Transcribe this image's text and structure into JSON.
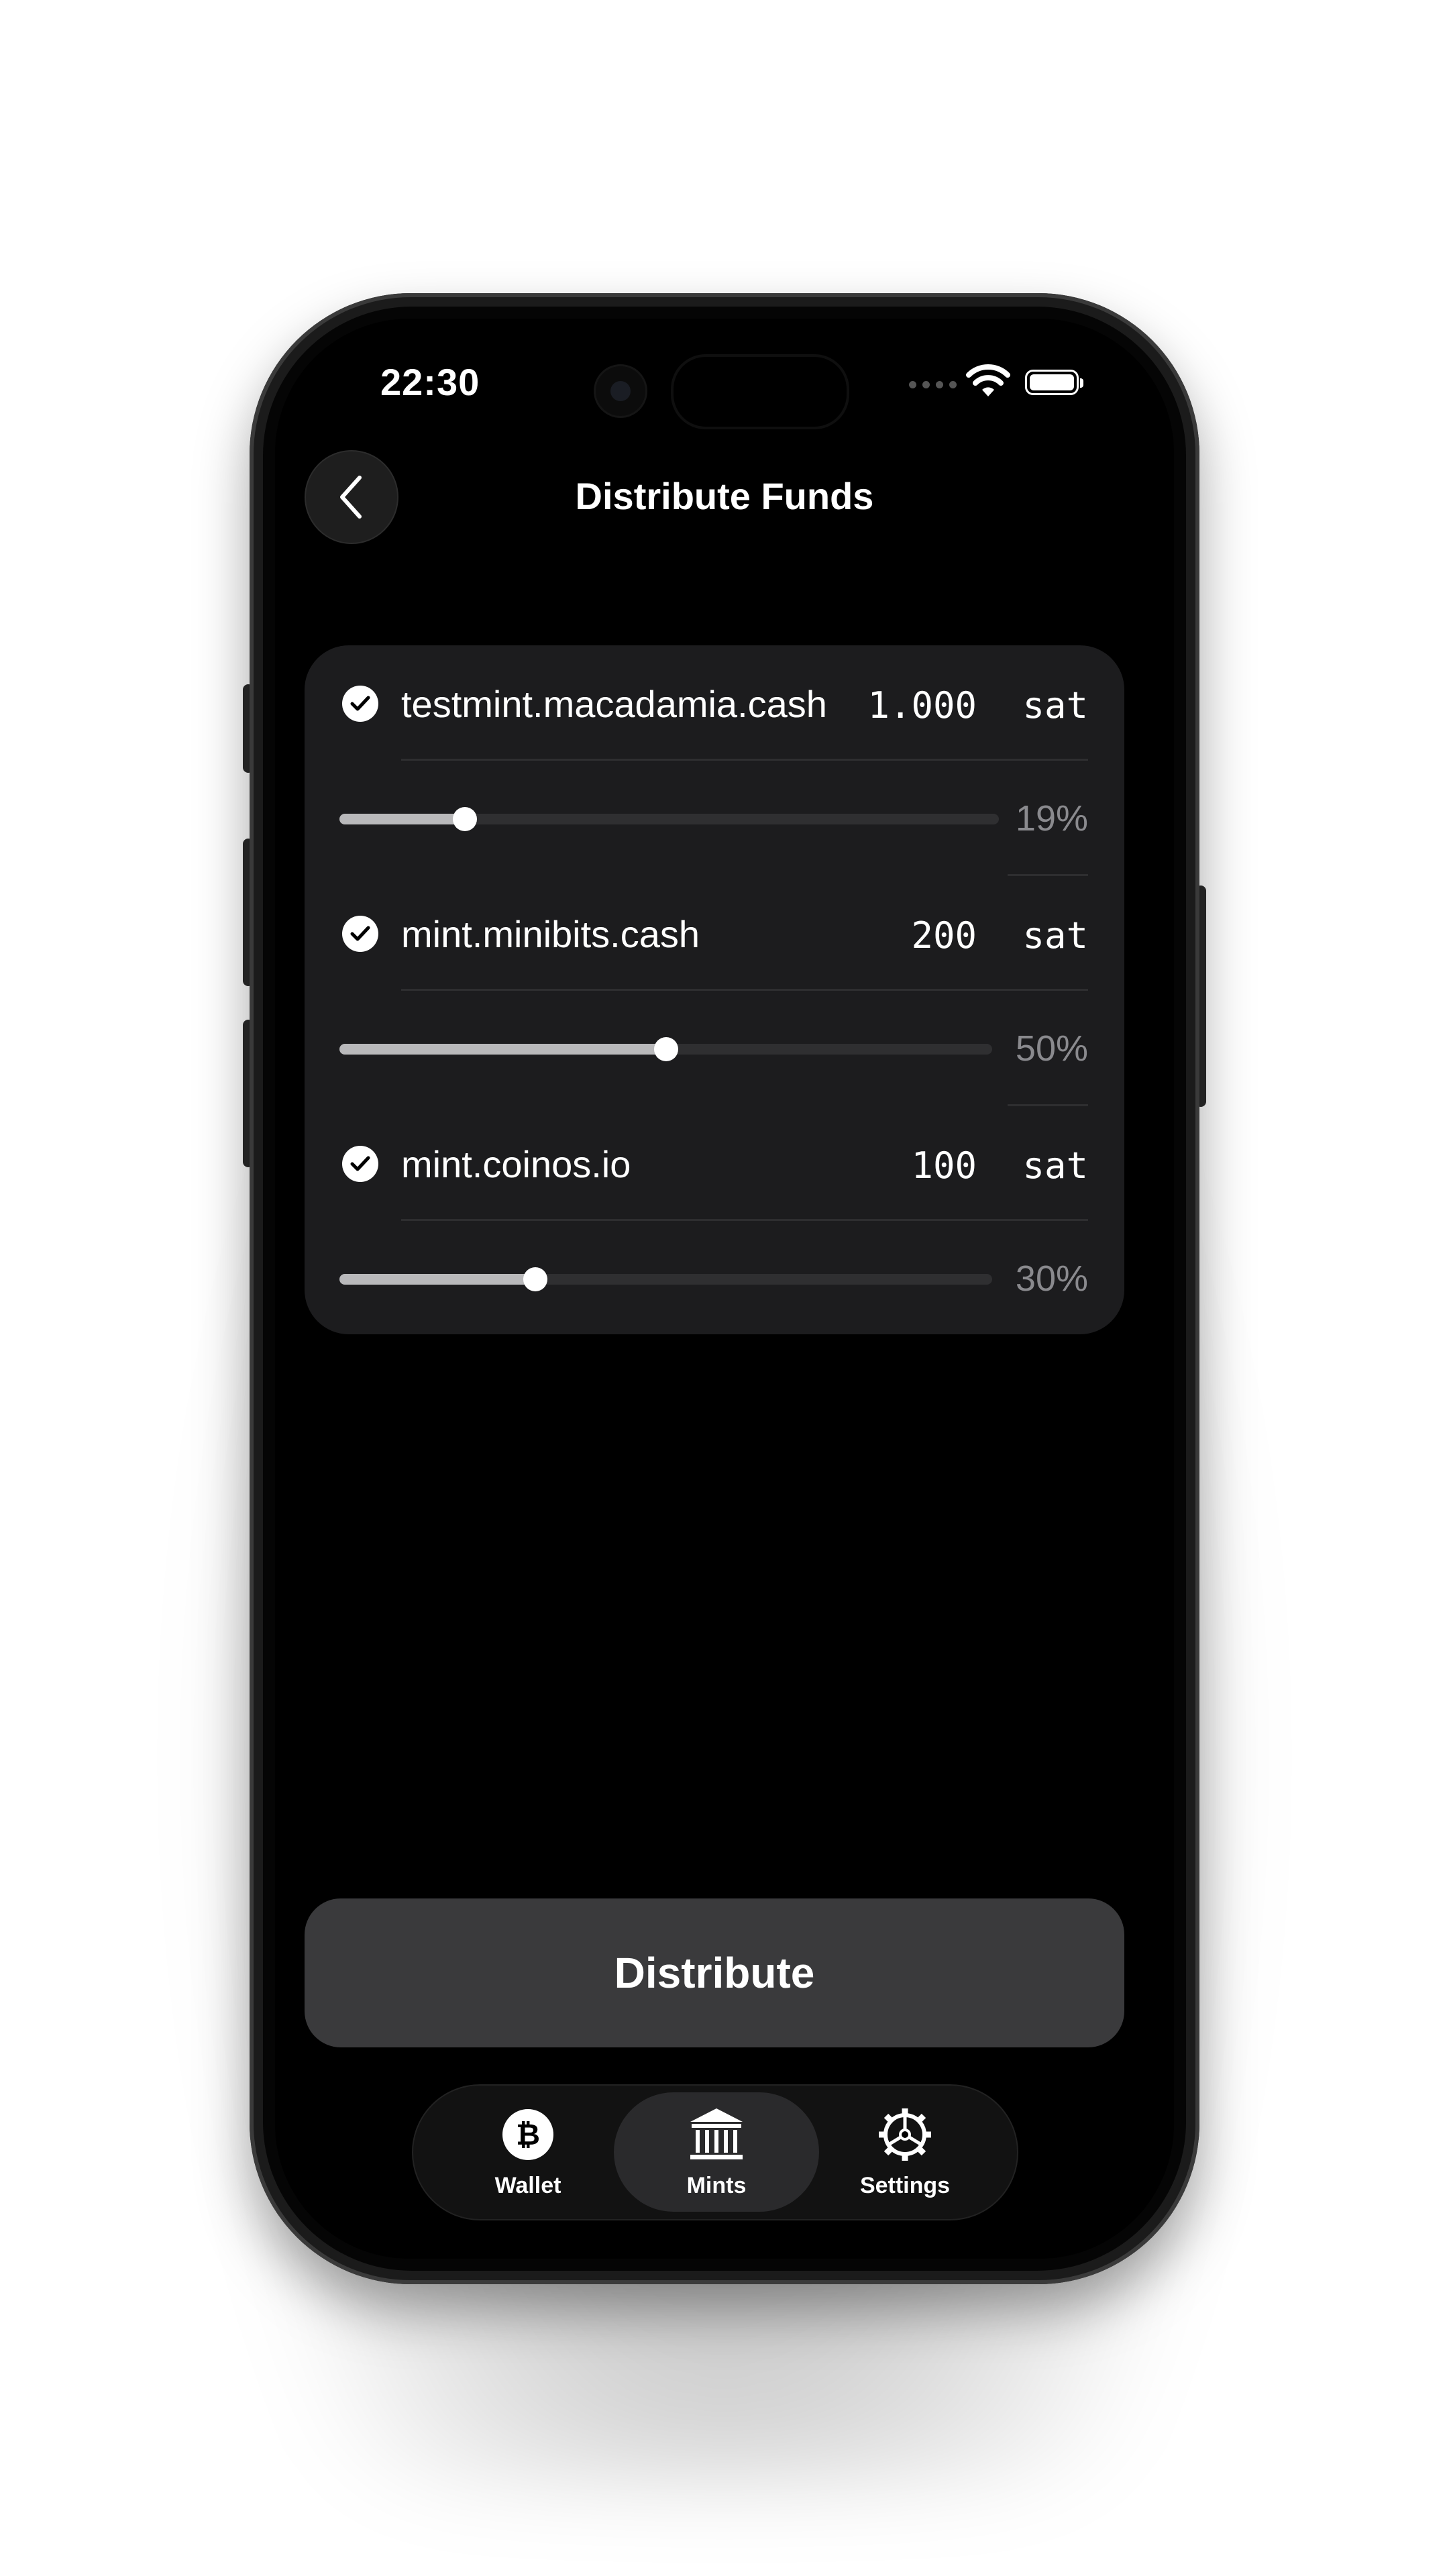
{
  "status_bar": {
    "time": "22:30"
  },
  "header": {
    "title": "Distribute Funds"
  },
  "mints": [
    {
      "name": "testmint.macadamia.cash",
      "amount": "1.000",
      "unit": "sat",
      "percent_label": "19%",
      "percent": 0.19
    },
    {
      "name": "mint.minibits.cash",
      "amount": "200",
      "unit": "sat",
      "percent_label": "50%",
      "percent": 0.5
    },
    {
      "name": "mint.coinos.io",
      "amount": "100",
      "unit": "sat",
      "percent_label": "30%",
      "percent": 0.3
    }
  ],
  "actions": {
    "distribute_label": "Distribute"
  },
  "tabbar": {
    "items": [
      {
        "label": "Wallet",
        "icon": "bitcoin-icon",
        "active": false
      },
      {
        "label": "Mints",
        "icon": "bank-icon",
        "active": true
      },
      {
        "label": "Settings",
        "icon": "gear-icon",
        "active": false
      }
    ]
  },
  "colors": {
    "background": "#000000",
    "card": "#1c1c1e",
    "button": "#3a3a3c",
    "accent": "#ffffff",
    "muted": "#8a8a8e"
  }
}
